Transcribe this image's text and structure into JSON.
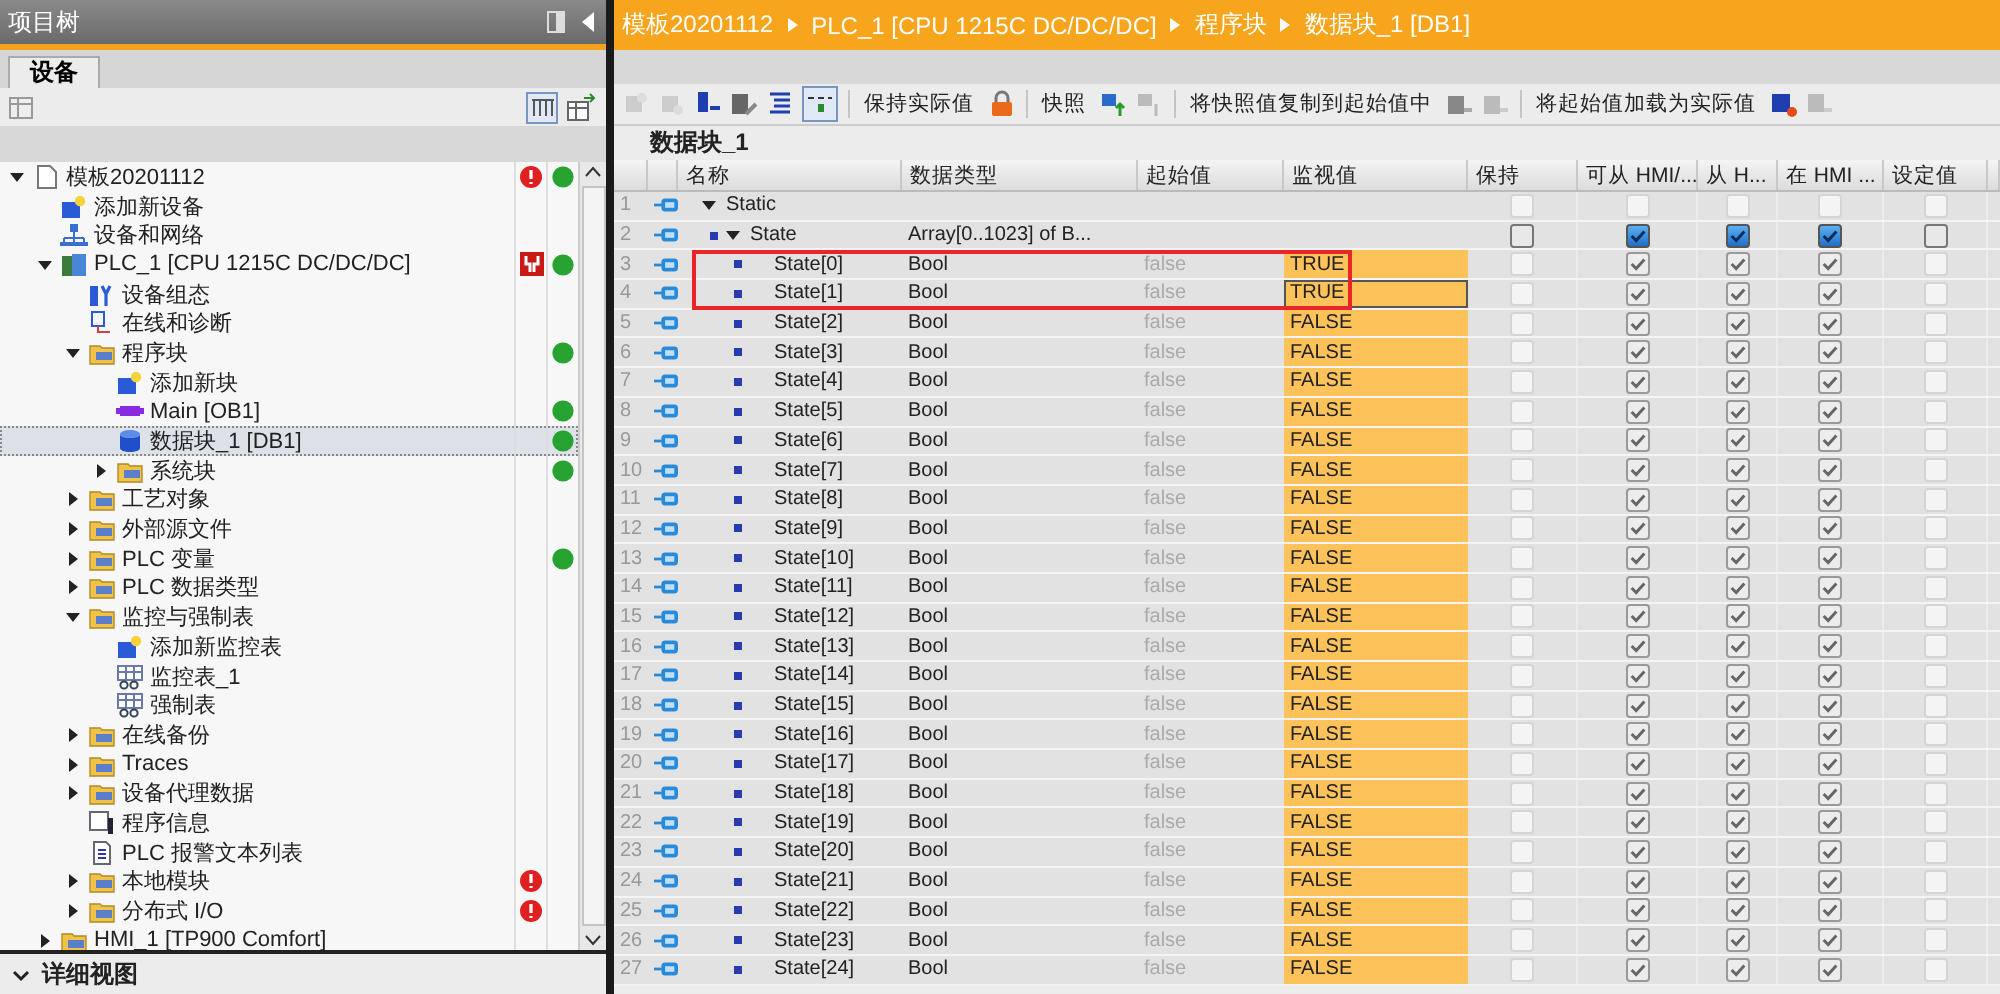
{
  "project_tree": {
    "title": "项目树",
    "tabs": [
      {
        "label": "设备",
        "selected": true
      }
    ],
    "items": [
      {
        "label": "模板20201112",
        "kind": "project",
        "expanded": true,
        "selected": false,
        "error": true,
        "maintenance": false,
        "online": true,
        "children": [
          {
            "label": "添加新设备",
            "kind": "add",
            "selected": false,
            "error": false,
            "maintenance": false,
            "online": false
          },
          {
            "label": "设备和网络",
            "kind": "network",
            "selected": false,
            "error": false,
            "maintenance": false,
            "online": false
          },
          {
            "label": "PLC_1 [CPU 1215C DC/DC/DC]",
            "kind": "plc",
            "expanded": true,
            "selected": false,
            "error": false,
            "maintenance": true,
            "online": true,
            "children": [
              {
                "label": "设备组态",
                "kind": "config",
                "selected": false,
                "error": false,
                "maintenance": false,
                "online": false
              },
              {
                "label": "在线和诊断",
                "kind": "diag",
                "selected": false,
                "error": false,
                "maintenance": false,
                "online": false
              },
              {
                "label": "程序块",
                "kind": "folder",
                "expanded": true,
                "selected": false,
                "error": false,
                "maintenance": false,
                "online": true,
                "children": [
                  {
                    "label": "添加新块",
                    "kind": "add",
                    "selected": false,
                    "error": false,
                    "maintenance": false,
                    "online": false
                  },
                  {
                    "label": "Main [OB1]",
                    "kind": "ob",
                    "selected": false,
                    "error": false,
                    "maintenance": false,
                    "online": true
                  },
                  {
                    "label": "数据块_1 [DB1]",
                    "kind": "db",
                    "selected": true,
                    "error": false,
                    "maintenance": false,
                    "online": true
                  },
                  {
                    "label": "系统块",
                    "kind": "folder",
                    "expanded": false,
                    "selected": false,
                    "error": false,
                    "maintenance": false,
                    "online": true
                  }
                ]
              },
              {
                "label": "工艺对象",
                "kind": "folder",
                "expanded": false,
                "selected": false,
                "error": false,
                "maintenance": false,
                "online": false
              },
              {
                "label": "外部源文件",
                "kind": "folder",
                "expanded": false,
                "selected": false,
                "error": false,
                "maintenance": false,
                "online": false
              },
              {
                "label": "PLC 变量",
                "kind": "folder",
                "expanded": false,
                "selected": false,
                "error": false,
                "maintenance": false,
                "online": true
              },
              {
                "label": "PLC 数据类型",
                "kind": "folder",
                "expanded": false,
                "selected": false,
                "error": false,
                "maintenance": false,
                "online": false
              },
              {
                "label": "监控与强制表",
                "kind": "folder",
                "expanded": true,
                "selected": false,
                "error": false,
                "maintenance": false,
                "online": false,
                "children": [
                  {
                    "label": "添加新监控表",
                    "kind": "add",
                    "selected": false,
                    "error": false,
                    "maintenance": false,
                    "online": false
                  },
                  {
                    "label": "监控表_1",
                    "kind": "table",
                    "selected": false,
                    "error": false,
                    "maintenance": false,
                    "online": false
                  },
                  {
                    "label": "强制表",
                    "kind": "table",
                    "selected": false,
                    "error": false,
                    "maintenance": false,
                    "online": false
                  }
                ]
              },
              {
                "label": "在线备份",
                "kind": "folder",
                "expanded": false,
                "selected": false,
                "error": false,
                "maintenance": false,
                "online": false
              },
              {
                "label": "Traces",
                "kind": "folder",
                "expanded": false,
                "selected": false,
                "error": false,
                "maintenance": false,
                "online": false
              },
              {
                "label": "设备代理数据",
                "kind": "folder",
                "expanded": false,
                "selected": false,
                "error": false,
                "maintenance": false,
                "online": false
              },
              {
                "label": "程序信息",
                "kind": "info",
                "selected": false,
                "error": false,
                "maintenance": false,
                "online": false
              },
              {
                "label": "PLC 报警文本列表",
                "kind": "list",
                "selected": false,
                "error": false,
                "maintenance": false,
                "online": false
              },
              {
                "label": "本地模块",
                "kind": "folder",
                "expanded": false,
                "selected": false,
                "error": true,
                "maintenance": false,
                "online": false
              },
              {
                "label": "分布式 I/O",
                "kind": "folder",
                "expanded": false,
                "selected": false,
                "error": true,
                "maintenance": false,
                "online": false
              }
            ]
          },
          {
            "label": "HMI_1 [TP900 Comfort]",
            "kind": "folder",
            "expanded": false,
            "selected": false,
            "error": false,
            "maintenance": false,
            "online": false
          }
        ]
      }
    ],
    "detail_view": {
      "label": "详细视图",
      "expanded": false
    }
  },
  "editor": {
    "breadcrumb": [
      "模板20201112",
      "PLC_1 [CPU 1215C DC/DC/DC]",
      "程序块",
      "数据块_1 [DB1]"
    ],
    "toolbar": [
      "保持实际值",
      "快照",
      "将快照值复制到起始值中",
      "将起始值加载为实际值"
    ],
    "title": "数据块_1",
    "table": {
      "columns": [
        "名称",
        "数据类型",
        "起始值",
        "监视值",
        "保持",
        "可从 HMI/...",
        "从 H...",
        "在 HMI ...",
        "设定值"
      ],
      "rows": [
        {
          "number": "1",
          "name": "Static",
          "expanded": true,
          "boxed": false,
          "focused": false,
          "checks": [
            {
              "checked": false,
              "disabled": true
            },
            {
              "checked": false,
              "disabled": true
            },
            {
              "checked": false,
              "disabled": true
            },
            {
              "checked": false,
              "disabled": true
            },
            {
              "checked": false,
              "disabled": true
            }
          ],
          "children": [
            {
              "number": "2",
              "name": "State",
              "type": "Array[0..1023] of B...",
              "expanded": true,
              "boxed": false,
              "focused": false,
              "checks": [
                {
                  "checked": false,
                  "disabled": false
                },
                {
                  "checked": true,
                  "disabled": false
                },
                {
                  "checked": true,
                  "disabled": false
                },
                {
                  "checked": true,
                  "disabled": false
                },
                {
                  "checked": false,
                  "disabled": false
                }
              ],
              "children": [
                {
                  "number": "3",
                  "name": "State[0]",
                  "type": "Bool",
                  "start": "false",
                  "monitor": "TRUE",
                  "boxed": true,
                  "focused": false,
                  "checks": [
                    {
                      "checked": false,
                      "disabled": true
                    },
                    {
                      "checked": true,
                      "disabled": true
                    },
                    {
                      "checked": true,
                      "disabled": true
                    },
                    {
                      "checked": true,
                      "disabled": true
                    },
                    {
                      "checked": false,
                      "disabled": true
                    }
                  ]
                },
                {
                  "number": "4",
                  "name": "State[1]",
                  "type": "Bool",
                  "start": "false",
                  "monitor": "TRUE",
                  "boxed": true,
                  "focused": true,
                  "checks": [
                    {
                      "checked": false,
                      "disabled": true
                    },
                    {
                      "checked": true,
                      "disabled": true
                    },
                    {
                      "checked": true,
                      "disabled": true
                    },
                    {
                      "checked": true,
                      "disabled": true
                    },
                    {
                      "checked": false,
                      "disabled": true
                    }
                  ]
                },
                {
                  "number": "5",
                  "name": "State[2]",
                  "type": "Bool",
                  "start": "false",
                  "monitor": "FALSE",
                  "boxed": false,
                  "focused": false,
                  "checks": [
                    {
                      "checked": false,
                      "disabled": true
                    },
                    {
                      "checked": true,
                      "disabled": true
                    },
                    {
                      "checked": true,
                      "disabled": true
                    },
                    {
                      "checked": true,
                      "disabled": true
                    },
                    {
                      "checked": false,
                      "disabled": true
                    }
                  ]
                },
                {
                  "number": "6",
                  "name": "State[3]",
                  "type": "Bool",
                  "start": "false",
                  "monitor": "FALSE",
                  "boxed": false,
                  "focused": false,
                  "checks": [
                    {
                      "checked": false,
                      "disabled": true
                    },
                    {
                      "checked": true,
                      "disabled": true
                    },
                    {
                      "checked": true,
                      "disabled": true
                    },
                    {
                      "checked": true,
                      "disabled": true
                    },
                    {
                      "checked": false,
                      "disabled": true
                    }
                  ]
                },
                {
                  "number": "7",
                  "name": "State[4]",
                  "type": "Bool",
                  "start": "false",
                  "monitor": "FALSE",
                  "boxed": false,
                  "focused": false,
                  "checks": [
                    {
                      "checked": false,
                      "disabled": true
                    },
                    {
                      "checked": true,
                      "disabled": true
                    },
                    {
                      "checked": true,
                      "disabled": true
                    },
                    {
                      "checked": true,
                      "disabled": true
                    },
                    {
                      "checked": false,
                      "disabled": true
                    }
                  ]
                },
                {
                  "number": "8",
                  "name": "State[5]",
                  "type": "Bool",
                  "start": "false",
                  "monitor": "FALSE",
                  "boxed": false,
                  "focused": false,
                  "checks": [
                    {
                      "checked": false,
                      "disabled": true
                    },
                    {
                      "checked": true,
                      "disabled": true
                    },
                    {
                      "checked": true,
                      "disabled": true
                    },
                    {
                      "checked": true,
                      "disabled": true
                    },
                    {
                      "checked": false,
                      "disabled": true
                    }
                  ]
                },
                {
                  "number": "9",
                  "name": "State[6]",
                  "type": "Bool",
                  "start": "false",
                  "monitor": "FALSE",
                  "boxed": false,
                  "focused": false,
                  "checks": [
                    {
                      "checked": false,
                      "disabled": true
                    },
                    {
                      "checked": true,
                      "disabled": true
                    },
                    {
                      "checked": true,
                      "disabled": true
                    },
                    {
                      "checked": true,
                      "disabled": true
                    },
                    {
                      "checked": false,
                      "disabled": true
                    }
                  ]
                },
                {
                  "number": "10",
                  "name": "State[7]",
                  "type": "Bool",
                  "start": "false",
                  "monitor": "FALSE",
                  "boxed": false,
                  "focused": false,
                  "checks": [
                    {
                      "checked": false,
                      "disabled": true
                    },
                    {
                      "checked": true,
                      "disabled": true
                    },
                    {
                      "checked": true,
                      "disabled": true
                    },
                    {
                      "checked": true,
                      "disabled": true
                    },
                    {
                      "checked": false,
                      "disabled": true
                    }
                  ]
                },
                {
                  "number": "11",
                  "name": "State[8]",
                  "type": "Bool",
                  "start": "false",
                  "monitor": "FALSE",
                  "boxed": false,
                  "focused": false,
                  "checks": [
                    {
                      "checked": false,
                      "disabled": true
                    },
                    {
                      "checked": true,
                      "disabled": true
                    },
                    {
                      "checked": true,
                      "disabled": true
                    },
                    {
                      "checked": true,
                      "disabled": true
                    },
                    {
                      "checked": false,
                      "disabled": true
                    }
                  ]
                },
                {
                  "number": "12",
                  "name": "State[9]",
                  "type": "Bool",
                  "start": "false",
                  "monitor": "FALSE",
                  "boxed": false,
                  "focused": false,
                  "checks": [
                    {
                      "checked": false,
                      "disabled": true
                    },
                    {
                      "checked": true,
                      "disabled": true
                    },
                    {
                      "checked": true,
                      "disabled": true
                    },
                    {
                      "checked": true,
                      "disabled": true
                    },
                    {
                      "checked": false,
                      "disabled": true
                    }
                  ]
                },
                {
                  "number": "13",
                  "name": "State[10]",
                  "type": "Bool",
                  "start": "false",
                  "monitor": "FALSE",
                  "boxed": false,
                  "focused": false,
                  "checks": [
                    {
                      "checked": false,
                      "disabled": true
                    },
                    {
                      "checked": true,
                      "disabled": true
                    },
                    {
                      "checked": true,
                      "disabled": true
                    },
                    {
                      "checked": true,
                      "disabled": true
                    },
                    {
                      "checked": false,
                      "disabled": true
                    }
                  ]
                },
                {
                  "number": "14",
                  "name": "State[11]",
                  "type": "Bool",
                  "start": "false",
                  "monitor": "FALSE",
                  "boxed": false,
                  "focused": false,
                  "checks": [
                    {
                      "checked": false,
                      "disabled": true
                    },
                    {
                      "checked": true,
                      "disabled": true
                    },
                    {
                      "checked": true,
                      "disabled": true
                    },
                    {
                      "checked": true,
                      "disabled": true
                    },
                    {
                      "checked": false,
                      "disabled": true
                    }
                  ]
                },
                {
                  "number": "15",
                  "name": "State[12]",
                  "type": "Bool",
                  "start": "false",
                  "monitor": "FALSE",
                  "boxed": false,
                  "focused": false,
                  "checks": [
                    {
                      "checked": false,
                      "disabled": true
                    },
                    {
                      "checked": true,
                      "disabled": true
                    },
                    {
                      "checked": true,
                      "disabled": true
                    },
                    {
                      "checked": true,
                      "disabled": true
                    },
                    {
                      "checked": false,
                      "disabled": true
                    }
                  ]
                },
                {
                  "number": "16",
                  "name": "State[13]",
                  "type": "Bool",
                  "start": "false",
                  "monitor": "FALSE",
                  "boxed": false,
                  "focused": false,
                  "checks": [
                    {
                      "checked": false,
                      "disabled": true
                    },
                    {
                      "checked": true,
                      "disabled": true
                    },
                    {
                      "checked": true,
                      "disabled": true
                    },
                    {
                      "checked": true,
                      "disabled": true
                    },
                    {
                      "checked": false,
                      "disabled": true
                    }
                  ]
                },
                {
                  "number": "17",
                  "name": "State[14]",
                  "type": "Bool",
                  "start": "false",
                  "monitor": "FALSE",
                  "boxed": false,
                  "focused": false,
                  "checks": [
                    {
                      "checked": false,
                      "disabled": true
                    },
                    {
                      "checked": true,
                      "disabled": true
                    },
                    {
                      "checked": true,
                      "disabled": true
                    },
                    {
                      "checked": true,
                      "disabled": true
                    },
                    {
                      "checked": false,
                      "disabled": true
                    }
                  ]
                },
                {
                  "number": "18",
                  "name": "State[15]",
                  "type": "Bool",
                  "start": "false",
                  "monitor": "FALSE",
                  "boxed": false,
                  "focused": false,
                  "checks": [
                    {
                      "checked": false,
                      "disabled": true
                    },
                    {
                      "checked": true,
                      "disabled": true
                    },
                    {
                      "checked": true,
                      "disabled": true
                    },
                    {
                      "checked": true,
                      "disabled": true
                    },
                    {
                      "checked": false,
                      "disabled": true
                    }
                  ]
                },
                {
                  "number": "19",
                  "name": "State[16]",
                  "type": "Bool",
                  "start": "false",
                  "monitor": "FALSE",
                  "boxed": false,
                  "focused": false,
                  "checks": [
                    {
                      "checked": false,
                      "disabled": true
                    },
                    {
                      "checked": true,
                      "disabled": true
                    },
                    {
                      "checked": true,
                      "disabled": true
                    },
                    {
                      "checked": true,
                      "disabled": true
                    },
                    {
                      "checked": false,
                      "disabled": true
                    }
                  ]
                },
                {
                  "number": "20",
                  "name": "State[17]",
                  "type": "Bool",
                  "start": "false",
                  "monitor": "FALSE",
                  "boxed": false,
                  "focused": false,
                  "checks": [
                    {
                      "checked": false,
                      "disabled": true
                    },
                    {
                      "checked": true,
                      "disabled": true
                    },
                    {
                      "checked": true,
                      "disabled": true
                    },
                    {
                      "checked": true,
                      "disabled": true
                    },
                    {
                      "checked": false,
                      "disabled": true
                    }
                  ]
                },
                {
                  "number": "21",
                  "name": "State[18]",
                  "type": "Bool",
                  "start": "false",
                  "monitor": "FALSE",
                  "boxed": false,
                  "focused": false,
                  "checks": [
                    {
                      "checked": false,
                      "disabled": true
                    },
                    {
                      "checked": true,
                      "disabled": true
                    },
                    {
                      "checked": true,
                      "disabled": true
                    },
                    {
                      "checked": true,
                      "disabled": true
                    },
                    {
                      "checked": false,
                      "disabled": true
                    }
                  ]
                },
                {
                  "number": "22",
                  "name": "State[19]",
                  "type": "Bool",
                  "start": "false",
                  "monitor": "FALSE",
                  "boxed": false,
                  "focused": false,
                  "checks": [
                    {
                      "checked": false,
                      "disabled": true
                    },
                    {
                      "checked": true,
                      "disabled": true
                    },
                    {
                      "checked": true,
                      "disabled": true
                    },
                    {
                      "checked": true,
                      "disabled": true
                    },
                    {
                      "checked": false,
                      "disabled": true
                    }
                  ]
                },
                {
                  "number": "23",
                  "name": "State[20]",
                  "type": "Bool",
                  "start": "false",
                  "monitor": "FALSE",
                  "boxed": false,
                  "focused": false,
                  "checks": [
                    {
                      "checked": false,
                      "disabled": true
                    },
                    {
                      "checked": true,
                      "disabled": true
                    },
                    {
                      "checked": true,
                      "disabled": true
                    },
                    {
                      "checked": true,
                      "disabled": true
                    },
                    {
                      "checked": false,
                      "disabled": true
                    }
                  ]
                },
                {
                  "number": "24",
                  "name": "State[21]",
                  "type": "Bool",
                  "start": "false",
                  "monitor": "FALSE",
                  "boxed": false,
                  "focused": false,
                  "checks": [
                    {
                      "checked": false,
                      "disabled": true
                    },
                    {
                      "checked": true,
                      "disabled": true
                    },
                    {
                      "checked": true,
                      "disabled": true
                    },
                    {
                      "checked": true,
                      "disabled": true
                    },
                    {
                      "checked": false,
                      "disabled": true
                    }
                  ]
                },
                {
                  "number": "25",
                  "name": "State[22]",
                  "type": "Bool",
                  "start": "false",
                  "monitor": "FALSE",
                  "boxed": false,
                  "focused": false,
                  "checks": [
                    {
                      "checked": false,
                      "disabled": true
                    },
                    {
                      "checked": true,
                      "disabled": true
                    },
                    {
                      "checked": true,
                      "disabled": true
                    },
                    {
                      "checked": true,
                      "disabled": true
                    },
                    {
                      "checked": false,
                      "disabled": true
                    }
                  ]
                },
                {
                  "number": "26",
                  "name": "State[23]",
                  "type": "Bool",
                  "start": "false",
                  "monitor": "FALSE",
                  "boxed": false,
                  "focused": false,
                  "checks": [
                    {
                      "checked": false,
                      "disabled": true
                    },
                    {
                      "checked": true,
                      "disabled": true
                    },
                    {
                      "checked": true,
                      "disabled": true
                    },
                    {
                      "checked": true,
                      "disabled": true
                    },
                    {
                      "checked": false,
                      "disabled": true
                    }
                  ]
                },
                {
                  "number": "27",
                  "name": "State[24]",
                  "type": "Bool",
                  "start": "false",
                  "monitor": "FALSE",
                  "boxed": false,
                  "focused": false,
                  "checks": [
                    {
                      "checked": false,
                      "disabled": true
                    },
                    {
                      "checked": true,
                      "disabled": true
                    },
                    {
                      "checked": true,
                      "disabled": true
                    },
                    {
                      "checked": true,
                      "disabled": true
                    },
                    {
                      "checked": false,
                      "disabled": true
                    }
                  ]
                }
              ]
            }
          ]
        }
      ]
    }
  }
}
